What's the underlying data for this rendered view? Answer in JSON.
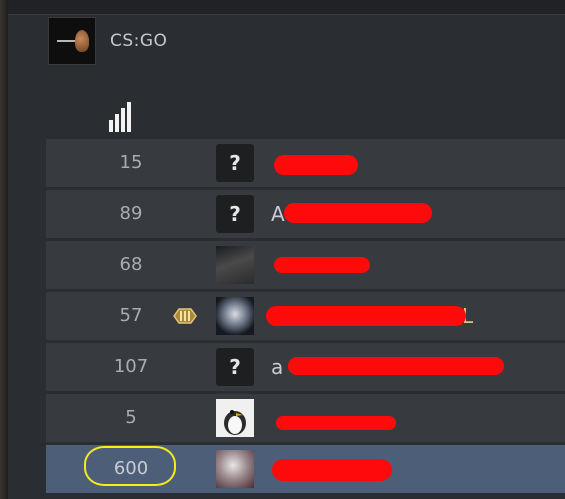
{
  "game": {
    "title": "CS:GO",
    "icon": "csgo-logo-icon"
  },
  "scoreboard": {
    "ping_header_icon": "signal-bars-icon",
    "rows": [
      {
        "ping": "15",
        "avatar": "?",
        "rank_icon": "",
        "name": "",
        "selected": false
      },
      {
        "ping": "89",
        "avatar": "?",
        "rank_icon": "",
        "name": "A",
        "selected": false
      },
      {
        "ping": "68",
        "avatar": "",
        "rank_icon": "",
        "name": "",
        "selected": false
      },
      {
        "ping": "57",
        "avatar": "",
        "rank_icon": "gold-rank-badge-icon",
        "name": "E L",
        "selected": false
      },
      {
        "ping": "107",
        "avatar": "?",
        "rank_icon": "",
        "name": "a",
        "selected": false
      },
      {
        "ping": "5",
        "avatar": "",
        "rank_icon": "",
        "name": "",
        "selected": false
      },
      {
        "ping": "600",
        "avatar": "",
        "rank_icon": "",
        "name": "",
        "selected": true
      }
    ]
  },
  "colors": {
    "redaction": "#ff0a0a",
    "highlight": "#f5ec19",
    "selected_row": "#4d5e78"
  }
}
